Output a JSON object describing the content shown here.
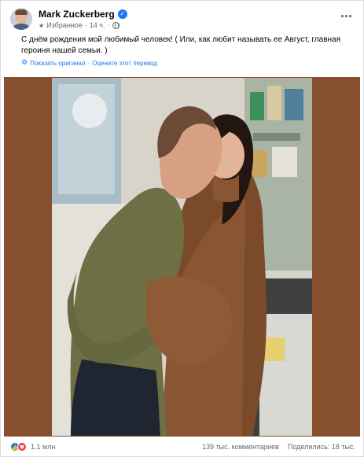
{
  "post": {
    "author": "Mark Zuckerberg",
    "verified_icon": "verified-badge-icon",
    "audience_label": "Избранное",
    "time": "14 ч.",
    "separator": "·",
    "text": "С днём рождения мой любимый человек! ( Или, как любит называть ее Август, главная героиня нашей семьи. )",
    "translation": {
      "show_original": "Показать оригинал",
      "separator": "·",
      "rate_translation": "Оцените этот перевод"
    },
    "photo": {
      "frame_color": "#864f2d",
      "description_icon": "photo"
    }
  },
  "footer": {
    "reactions_count": "1,1 млн",
    "comments": "139 тыс. комментариев",
    "shares": "Поделились: 18 тыс."
  },
  "colors": {
    "accent": "#1877f2",
    "secondary_text": "#65676b",
    "love": "#f33e58"
  }
}
